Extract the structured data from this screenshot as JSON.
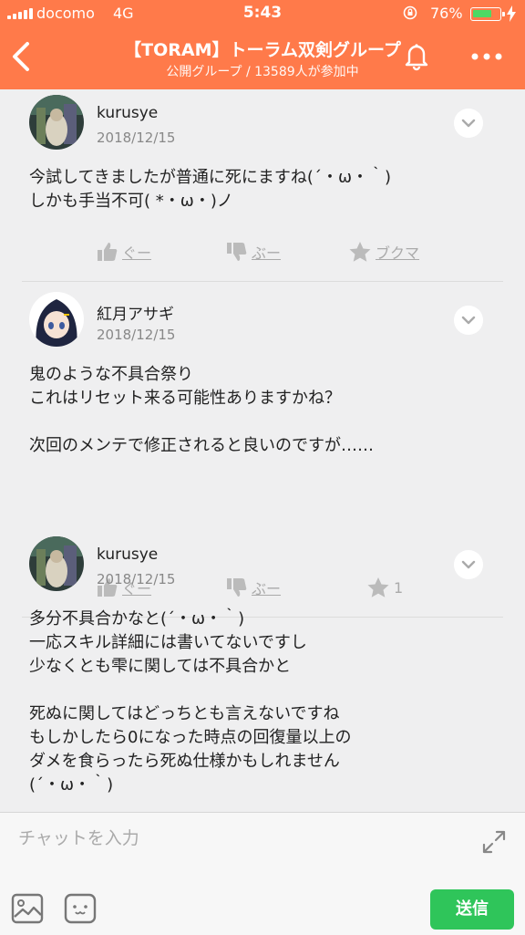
{
  "status": {
    "carrier": "docomo",
    "network": "4G",
    "time": "5:43",
    "battery_pct": "76%",
    "battery_level": 0.76
  },
  "header": {
    "title": "【TORAM】トーラム双剣グループ",
    "subtitle": "公開グループ / 13589人が参加中"
  },
  "posts": [
    {
      "user": "kurusye",
      "date": "2018/12/15",
      "lines": [
        "今試してきましたが普通に死にますね(´・ω・｀)",
        "しかも手当不可( *・ω・)ノ"
      ],
      "good": "ぐー",
      "boo": "ぶー",
      "third": "ブクマ"
    },
    {
      "user": "紅月アサギ",
      "date": "2018/12/15",
      "lines": [
        "鬼のような不具合祭り",
        "これはリセット来る可能性ありますかね？",
        "",
        "次回のメンテで修正されると良いのですが……"
      ],
      "good": "ぐー",
      "boo": "ぶー",
      "third": "1"
    },
    {
      "user": "kurusye",
      "date": "2018/12/15",
      "lines": [
        "多分不具合かなと(´・ω・｀)",
        "一応スキル詳細には書いてないですし",
        "少なくとも雫に関しては不具合かと",
        "",
        "死ぬに関してはどっちとも言えないですね",
        "もしかしたら0になった時点の回復量以上の",
        "ダメを食らったら死ぬ仕様かもしれません",
        "(´・ω・｀)"
      ]
    }
  ],
  "composer": {
    "placeholder": "チャットを入力",
    "send": "送信"
  },
  "colors": {
    "header": "#ff7a4a",
    "send": "#2fc55a",
    "background": "#efeff0"
  }
}
